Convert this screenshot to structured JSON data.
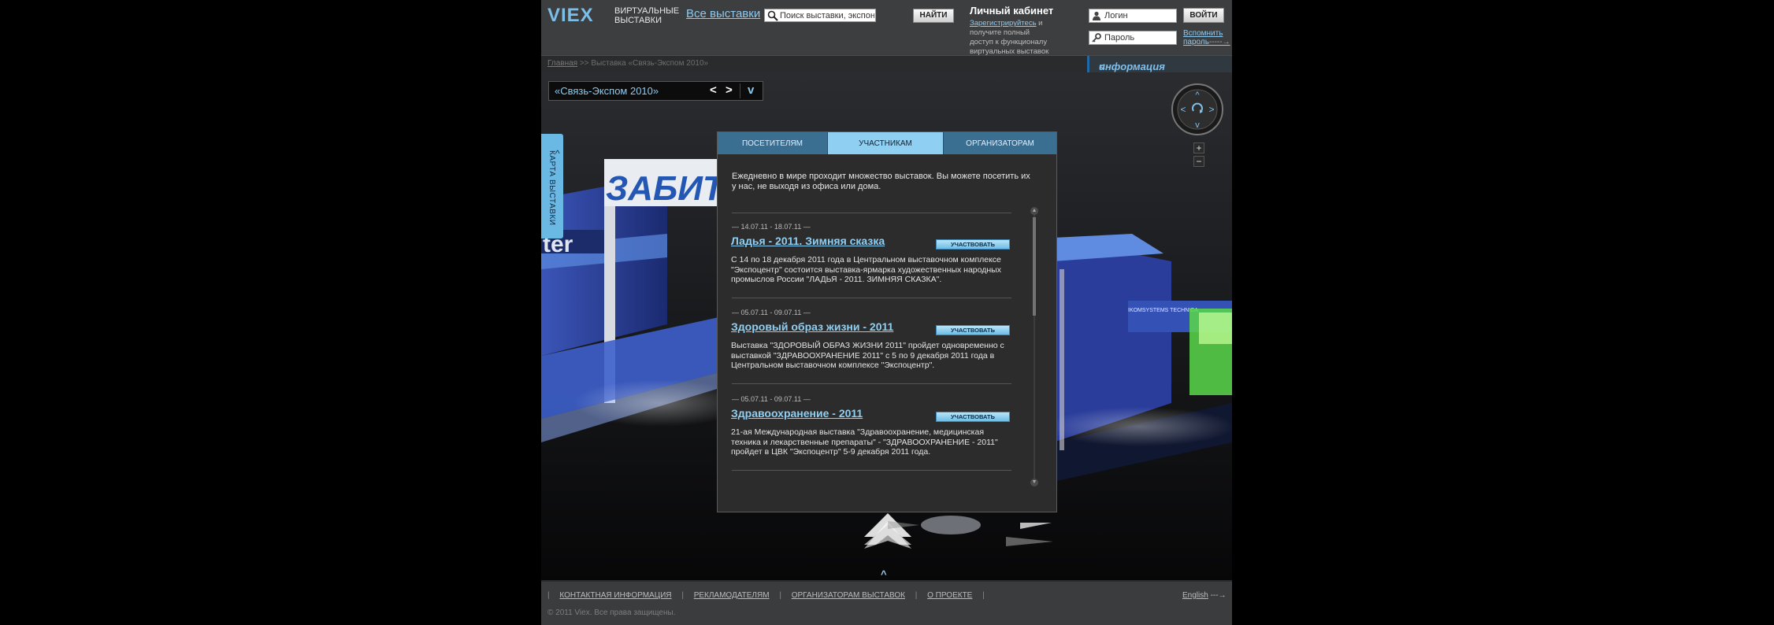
{
  "header": {
    "logo": "VIEX",
    "logo_text_1": "ВИРТУАЛЬНЫЕ",
    "logo_text_2": "ВЫСТАВКИ",
    "all_exhibitions": "Все выставки",
    "search_placeholder": "Поиск выставки, экспонента",
    "search_button": "НАЙТИ",
    "cabinet_title": "Личный кабинет",
    "cabinet_register_link": "Зарегистрируйтесь",
    "cabinet_text": " и получите полный доступ к функционалу виртуальных выставок",
    "login_placeholder": "Логин",
    "password_placeholder": "Пароль",
    "login_button": "ВОЙТИ",
    "forgot_line1": "Вспомнить",
    "forgot_line2": "пароль",
    "forgot_arrow": "-----→"
  },
  "breadcrumbs": {
    "home": "Главная",
    "separator": " >> ",
    "current": "Выставка «Связь-Экспом 2010»"
  },
  "info_tab": {
    "arrow": "<",
    "label": "информация"
  },
  "selector": {
    "name": "«Связь-Экспом 2010»",
    "prev": "<",
    "next": ">",
    "expand": "v"
  },
  "map_tab": {
    "label": "КАРТА ВЫСТАВКИ",
    "chevron": "^"
  },
  "zoom": {
    "plus": "+",
    "minus": "−"
  },
  "scene": {
    "sign_text": "ЗАБИТЕХ",
    "sign_fragment": "ter",
    "booth_brand": "IKOMSYSTEMS TECHNICA"
  },
  "panel": {
    "tabs": [
      "ПОСЕТИТЕЛЯМ",
      "УЧАСТНИКАМ",
      "ОРГАНИЗАТОРАМ"
    ],
    "active_tab": 1,
    "intro": "Ежедневно в мире проходит множество выставок. Вы можете посетить их у нас, не выходя из офиса или дома.",
    "participate_label": "УЧАСТВОВАТЬ",
    "events": [
      {
        "date": "— 14.07.11 - 18.07.11 —",
        "title": "Ладья - 2011. Зимняя сказка",
        "description": "С 14 по 18 декабря 2011 года в Центральном выставочном комплексе \"Экспоцентр\" состоится выставка-ярмарка художественных народных промыслов России \"ЛАДЬЯ - 2011. ЗИМНЯЯ СКАЗКА\"."
      },
      {
        "date": "— 05.07.11 - 09.07.11 —",
        "title": "Здоровый образ жизни - 2011",
        "description": "Выставка \"ЗДОРОВЫЙ ОБРАЗ ЖИЗНИ 2011\" пройдет одновременно с выставкой \"ЗДРАВООХРАНЕНИЕ 2011\" с 5 по 9 декабря 2011 года в Центральном выставочном комплексе \"Экспоцентр\"."
      },
      {
        "date": "— 05.07.11 - 09.07.11 —",
        "title": "Здравоохранение - 2011",
        "description": "21-ая Международная выставка \"Здравоохранение, медицинская техника и лекарственные препараты\" - \"ЗДРАВООХРАНЕНИЕ - 2011\" пройдет в ЦВК \"Экспоцентр\" 5-9 декабря 2011 года."
      }
    ]
  },
  "bottom_arrow": "^",
  "footer": {
    "links": [
      "КОНТАКТНАЯ ИНФОРМАЦИЯ",
      "РЕКЛАМОДАТЕЛЯМ",
      "ОРГАНИЗАТОРАМ ВЫСТАВОК",
      "О ПРОЕКТЕ"
    ],
    "pipe": "|",
    "english": "English",
    "english_arrow": "---→",
    "copyright": "© 2011 Viex. Все права защищены."
  },
  "colors": {
    "accent": "#8fc9ee",
    "tab_bar": "#3b6f92",
    "tab_active": "#8fd0f2",
    "header_bg": "#3d3e40",
    "panel_bg": "#2c2c2c"
  }
}
